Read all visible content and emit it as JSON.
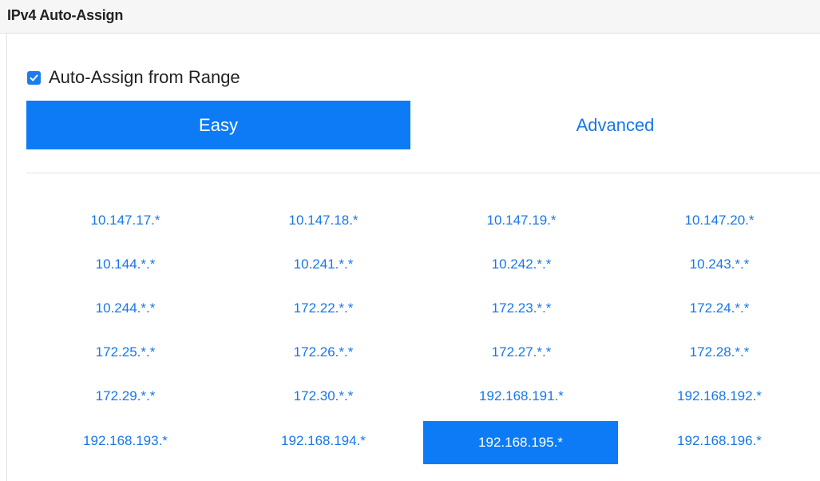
{
  "header": {
    "title": "IPv4 Auto-Assign"
  },
  "auto_assign": {
    "label": "Auto-Assign from Range",
    "checked": true
  },
  "tabs": [
    {
      "label": "Easy",
      "selected": true
    },
    {
      "label": "Advanced",
      "selected": false
    }
  ],
  "ranges": [
    [
      "10.147.17.*",
      "10.147.18.*",
      "10.147.19.*",
      "10.147.20.*"
    ],
    [
      "10.144.*.*",
      "10.241.*.*",
      "10.242.*.*",
      "10.243.*.*"
    ],
    [
      "10.244.*.*",
      "172.22.*.*",
      "172.23.*.*",
      "172.24.*.*"
    ],
    [
      "172.25.*.*",
      "172.26.*.*",
      "172.27.*.*",
      "172.28.*.*"
    ],
    [
      "172.29.*.*",
      "172.30.*.*",
      "192.168.191.*",
      "192.168.192.*"
    ],
    [
      "192.168.193.*",
      "192.168.194.*",
      "192.168.195.*",
      "192.168.196.*"
    ]
  ],
  "selected_range": "192.168.195.*",
  "colors": {
    "accent": "#0c7bf5",
    "link": "#1877e8",
    "header_bg": "#f6f6f6"
  }
}
